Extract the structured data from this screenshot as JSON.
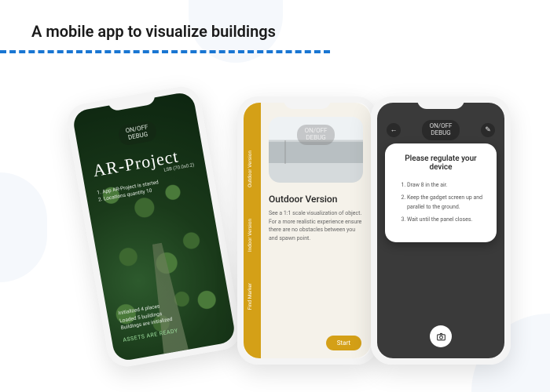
{
  "heading": "A mobile app to visualize buildings",
  "phone1": {
    "debug_pill_line1": "ON/OFF",
    "debug_pill_line2": "DEBUG",
    "title": "AR-Project",
    "subright": "LSB (70.0x0.2)",
    "boot_log": [
      "1.  App AR-Project is started",
      "2.  Locations quantity 10"
    ],
    "status_lines": [
      "Initialized 4 places",
      "Loaded 5 buildings",
      "Buildings are initialized"
    ],
    "ready": "ASSETS ARE READY"
  },
  "phone2": {
    "debug_pill_line1": "ON/OFF",
    "debug_pill_line2": "DEBUG",
    "sidebar": {
      "items": [
        {
          "label": "Outdoor Version"
        },
        {
          "label": "Indoor Version"
        },
        {
          "label": "Find Marker"
        }
      ]
    },
    "section_title": "Outdoor Version",
    "description": "See a 1:1 scale visualization of object. For a more realistic experience ensure there are no obstacles between you and spawn point.",
    "start_label": "Start"
  },
  "phone3": {
    "debug_pill_line1": "ON/OFF",
    "debug_pill_line2": "DEBUG",
    "card_title": "Please regulate your device",
    "instructions": [
      "Draw 8 in the air.",
      "Keep the gadget screen up and parallel to the ground.",
      "Wait until the panel closes."
    ]
  },
  "colors": {
    "accent_blue": "#1976d2",
    "accent_yellow": "#d4a017",
    "dark": "#3a3a3a"
  }
}
